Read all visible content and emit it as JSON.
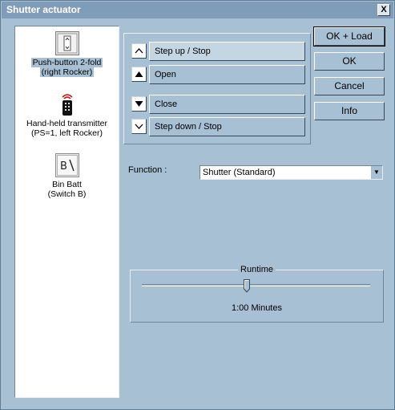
{
  "window": {
    "title": "Shutter actuator",
    "close_glyph": "X"
  },
  "devices": [
    {
      "line1": "Push-button 2-fold",
      "line2": "(right Rocker)",
      "icon": "push-button-icon",
      "selected": true
    },
    {
      "line1": "Hand-held transmitter",
      "line2": "(PS=1, left Rocker)",
      "icon": "remote-control-icon",
      "selected": false
    },
    {
      "line1": "Bin Batt",
      "line2": "(Switch B)",
      "icon": "switch-b-icon",
      "selected": false
    }
  ],
  "actions": [
    {
      "label": "Step up / Stop",
      "icon": "chevron-up-outline-icon"
    },
    {
      "label": "Open",
      "icon": "chevron-up-filled-icon"
    },
    {
      "label": "Close",
      "icon": "chevron-down-filled-icon"
    },
    {
      "label": "Step down / Stop",
      "icon": "chevron-down-outline-icon"
    }
  ],
  "buttons": {
    "ok_load": "OK + Load",
    "ok": "OK",
    "cancel": "Cancel",
    "info": "Info"
  },
  "function": {
    "label": "Function :",
    "value": "Shutter (Standard)"
  },
  "runtime": {
    "title": "Runtime",
    "value": "1:00 Minutes",
    "slider_fraction": 0.46
  },
  "colors": {
    "background": "#a7c0d3",
    "titlebar": "#7f9db8",
    "list_selection": "#a7c0d3"
  }
}
